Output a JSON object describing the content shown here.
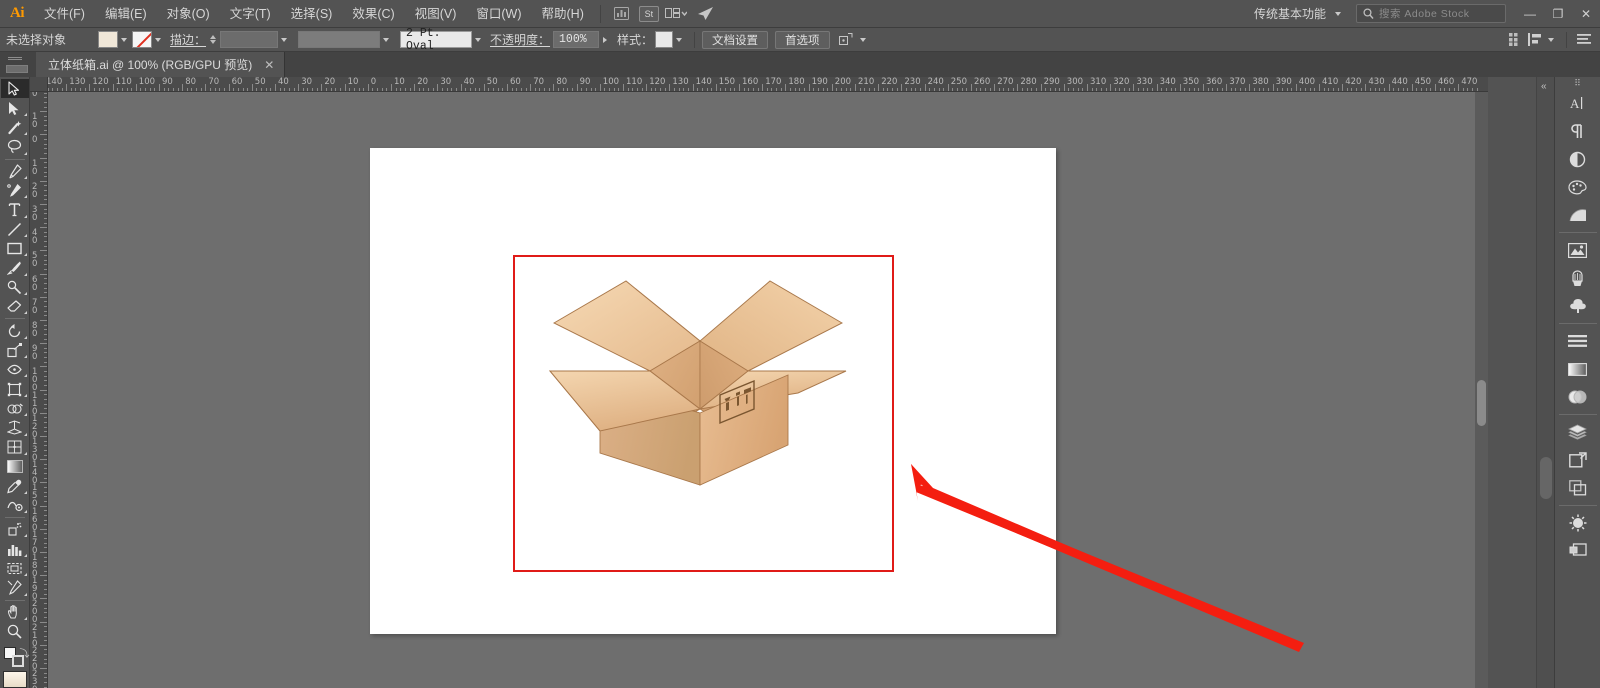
{
  "app": {
    "name": "Adobe Illustrator",
    "logo_text": "Ai",
    "accent_color": "#ff9a00",
    "chrome_bg": "#535353"
  },
  "menubar": {
    "items": [
      {
        "label": "文件(F)",
        "name": "menu-file"
      },
      {
        "label": "编辑(E)",
        "name": "menu-edit"
      },
      {
        "label": "对象(O)",
        "name": "menu-object"
      },
      {
        "label": "文字(T)",
        "name": "menu-type"
      },
      {
        "label": "选择(S)",
        "name": "menu-select"
      },
      {
        "label": "效果(C)",
        "name": "menu-effect"
      },
      {
        "label": "视图(V)",
        "name": "menu-view"
      },
      {
        "label": "窗口(W)",
        "name": "menu-window"
      },
      {
        "label": "帮助(H)",
        "name": "menu-help"
      }
    ],
    "icons": [
      {
        "name": "bridge-icon",
        "glyph": "Br"
      },
      {
        "name": "stock-icon",
        "glyph": "St"
      },
      {
        "name": "arrange-documents-icon",
        "glyph": "▤"
      },
      {
        "name": "share-icon",
        "glyph": "➤"
      }
    ],
    "workspace": {
      "label": "传统基本功能",
      "name": "workspace-switcher"
    },
    "search": {
      "placeholder": "搜索 Adobe Stock",
      "name": "adobe-stock-search"
    },
    "window_controls": {
      "minimize": "—",
      "restore": "❐",
      "close": "✕"
    }
  },
  "controlbar": {
    "selection_label": "未选择对象",
    "fill_color": "#f0e7d8",
    "stroke_label": "描边：",
    "stroke_value": "",
    "stroke_profile": "",
    "brush_label": "2 Pt. Oval",
    "opacity_label": "不透明度：",
    "opacity_value": "100%",
    "style_label": "样式：",
    "document_setup_label": "文档设置",
    "preferences_label": "首选项",
    "right_icons": [
      {
        "name": "arrange-grid-icon",
        "glyph": "⠿"
      },
      {
        "name": "align-panel-icon",
        "glyph": "▐"
      },
      {
        "name": "panel-menu-icon",
        "glyph": "☰"
      }
    ]
  },
  "tabbar": {
    "tab": {
      "title": "立体纸箱.ai @ 100% (RGB/GPU 预览)",
      "close_glyph": "✕",
      "name": "document-tab"
    }
  },
  "toolbar": {
    "tools": [
      {
        "name": "selection-tool",
        "label": "选择工具",
        "active": true
      },
      {
        "name": "direct-selection-tool",
        "label": "直接选择工具",
        "sub": true
      },
      {
        "name": "magic-wand-tool",
        "label": "魔棒工具"
      },
      {
        "name": "lasso-tool",
        "label": "套索工具"
      },
      {
        "name": "pen-tool",
        "label": "钢笔工具",
        "sub": true
      },
      {
        "name": "curvature-tool",
        "label": "曲率工具"
      },
      {
        "name": "type-tool",
        "label": "文字工具",
        "sub": true
      },
      {
        "name": "line-segment-tool",
        "label": "直线段工具",
        "sub": true
      },
      {
        "name": "rectangle-tool",
        "label": "矩形工具",
        "sub": true
      },
      {
        "name": "paintbrush-tool",
        "label": "画笔工具",
        "sub": true
      },
      {
        "name": "shaper-tool",
        "label": "Shaper 工具",
        "sub": true
      },
      {
        "name": "eraser-tool",
        "label": "橡皮擦工具",
        "sub": true
      },
      {
        "name": "rotate-tool",
        "label": "旋转工具",
        "sub": true
      },
      {
        "name": "scale-tool",
        "label": "比例缩放工具",
        "sub": true
      },
      {
        "name": "width-tool",
        "label": "宽度工具",
        "sub": true
      },
      {
        "name": "free-transform-tool",
        "label": "自由变换工具"
      },
      {
        "name": "shape-builder-tool",
        "label": "形状生成器工具",
        "sub": true
      },
      {
        "name": "perspective-grid-tool",
        "label": "透视网格工具",
        "sub": true
      },
      {
        "name": "mesh-tool",
        "label": "网格工具"
      },
      {
        "name": "gradient-tool",
        "label": "渐变工具"
      },
      {
        "name": "eyedropper-tool",
        "label": "吸管工具",
        "sub": true
      },
      {
        "name": "blend-tool",
        "label": "混合工具"
      },
      {
        "name": "symbol-sprayer-tool",
        "label": "符号喷枪工具",
        "sub": true
      },
      {
        "name": "column-graph-tool",
        "label": "柱形图工具",
        "sub": true
      },
      {
        "name": "artboard-tool",
        "label": "画板工具"
      },
      {
        "name": "slice-tool",
        "label": "切片工具",
        "sub": true
      },
      {
        "name": "hand-tool",
        "label": "抓手工具",
        "sub": true
      },
      {
        "name": "zoom-tool",
        "label": "缩放工具"
      }
    ],
    "fill_color": "#f6f6f6",
    "stroke_color": "#ffffff",
    "bottom_swatch": "#f3e9d7"
  },
  "rulers": {
    "unit": "mm",
    "h_labels": [
      "140",
      "130",
      "120",
      "110",
      "100",
      "90",
      "80",
      "70",
      "60",
      "50",
      "40",
      "30",
      "20",
      "10",
      "0",
      "10",
      "20",
      "30",
      "40",
      "50",
      "60",
      "70",
      "80",
      "90",
      "100",
      "110",
      "120",
      "130",
      "140",
      "150",
      "160",
      "170",
      "180",
      "190",
      "200",
      "210",
      "220",
      "230",
      "240",
      "250",
      "260",
      "270",
      "280",
      "290",
      "300",
      "310",
      "320",
      "330",
      "340",
      "350",
      "360",
      "370",
      "380",
      "390",
      "400",
      "410",
      "420",
      "430",
      "440",
      "450",
      "460",
      "470"
    ],
    "v_labels": [
      "0",
      "10",
      "0",
      "10",
      "20",
      "30",
      "40",
      "50",
      "60",
      "70",
      "80",
      "90",
      "100",
      "110",
      "120",
      "130",
      "140",
      "150",
      "160",
      "170",
      "180",
      "190",
      "200",
      "210",
      "220",
      "230"
    ]
  },
  "canvas": {
    "zoom": "100%",
    "artboard_bg": "#ffffff",
    "canvas_bg": "#6e6e6e",
    "annotation": {
      "rect_color": "#e01b18",
      "arrow_color": "#f41e10",
      "name": "annotation-arrow"
    },
    "artwork": {
      "name": "cardboard-box-illustration",
      "title": "立体纸箱",
      "colors": {
        "flap_light": "#f0cba2",
        "flap_mid": "#e3b584",
        "front": "#e0b184",
        "side": "#d6a374",
        "inner": "#d9a877",
        "outline": "#8a6239",
        "label": "#7a5630"
      }
    }
  },
  "dock": {
    "groups": [
      {
        "name": "type-color-group",
        "icons": [
          {
            "name": "character-panel-icon",
            "label": "字符"
          },
          {
            "name": "paragraph-panel-icon",
            "label": "段落"
          },
          {
            "name": "transparency-panel-icon",
            "label": "透明度"
          },
          {
            "name": "color-panel-icon",
            "label": "颜色"
          },
          {
            "name": "color-guide-panel-icon",
            "label": "颜色参考"
          }
        ]
      },
      {
        "name": "trace-brush-symbol-group",
        "icons": [
          {
            "name": "image-trace-panel-icon",
            "label": "图像描摹"
          },
          {
            "name": "brushes-panel-icon",
            "label": "画笔"
          },
          {
            "name": "symbols-panel-icon",
            "label": "符号"
          }
        ]
      },
      {
        "name": "align-gradient-appearance-group",
        "icons": [
          {
            "name": "align-panel-icon",
            "label": "对齐"
          },
          {
            "name": "gradient-panel-icon",
            "label": "渐变"
          },
          {
            "name": "appearance-panel-icon",
            "label": "外观"
          }
        ]
      },
      {
        "name": "layers-artboards-links-group",
        "icons": [
          {
            "name": "layers-panel-icon",
            "label": "图层"
          },
          {
            "name": "artboards-panel-icon",
            "label": "画板"
          },
          {
            "name": "links-panel-icon",
            "label": "链接"
          }
        ]
      },
      {
        "name": "effects-output-group",
        "icons": [
          {
            "name": "asset-export-panel-icon",
            "label": "资源导出"
          },
          {
            "name": "document-info-panel-icon",
            "label": "文档信息"
          }
        ]
      }
    ],
    "collapse_glyph": "«"
  }
}
